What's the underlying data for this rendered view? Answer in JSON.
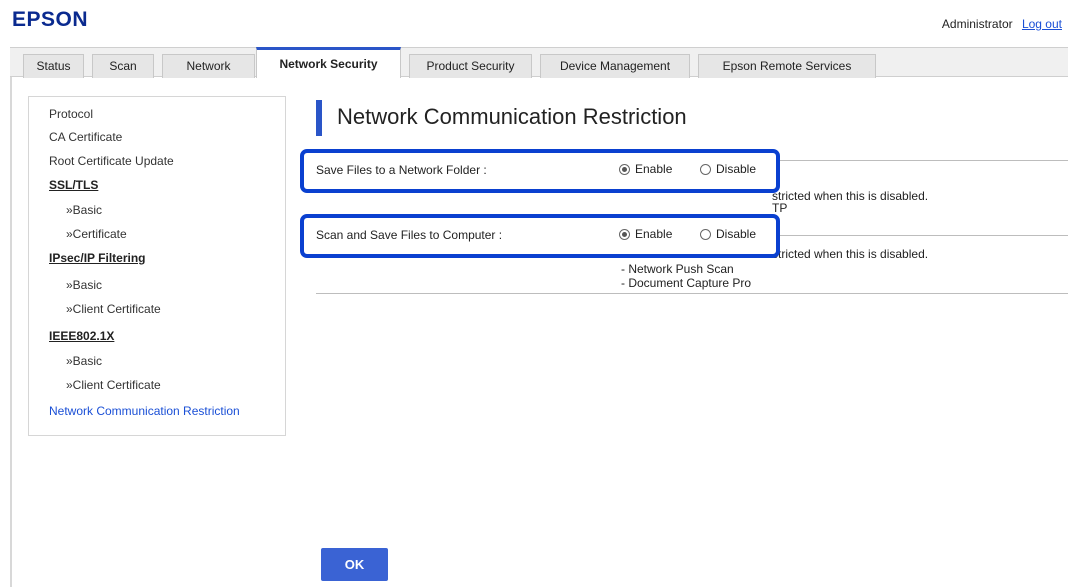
{
  "brand": {
    "logo": "EPSON"
  },
  "user": {
    "name": "Administrator",
    "logout": "Log out"
  },
  "tabs": [
    {
      "label": "Status"
    },
    {
      "label": "Scan"
    },
    {
      "label": "Network"
    },
    {
      "label": "Network Security",
      "active": true
    },
    {
      "label": "Product Security"
    },
    {
      "label": "Device Management"
    },
    {
      "label": "Epson Remote Services"
    }
  ],
  "sidebar": {
    "items": [
      {
        "label": "Protocol"
      },
      {
        "label": "CA Certificate"
      },
      {
        "label": "Root Certificate Update"
      },
      {
        "label": "SSL/TLS"
      },
      {
        "label": "»Basic"
      },
      {
        "label": "»Certificate"
      },
      {
        "label": "IPsec/IP Filtering"
      },
      {
        "label": "»Basic"
      },
      {
        "label": "»Client Certificate"
      },
      {
        "label": "IEEE802.1X"
      },
      {
        "label": "»Basic"
      },
      {
        "label": "»Client Certificate"
      },
      {
        "label": "Network Communication Restriction"
      }
    ]
  },
  "main": {
    "title": "Network Communication Restriction",
    "settings": [
      {
        "label": "Save Files to a Network Folder :",
        "enable": "Enable",
        "disable": "Disable",
        "selected": "Enable",
        "note": "stricted when this is disabled.",
        "note2": "TP"
      },
      {
        "label": "Scan and Save Files to Computer :",
        "enable": "Enable",
        "disable": "Disable",
        "selected": "Enable",
        "note": "stricted when this is disabled.",
        "list": [
          "- Network Push Scan",
          "- Document Capture Pro"
        ]
      }
    ],
    "ok_label": "OK"
  },
  "colors": {
    "accent": "#2a55c8",
    "highlight": "#0a40d0",
    "brand": "#0a2a8f",
    "link": "#1a4fd6"
  }
}
